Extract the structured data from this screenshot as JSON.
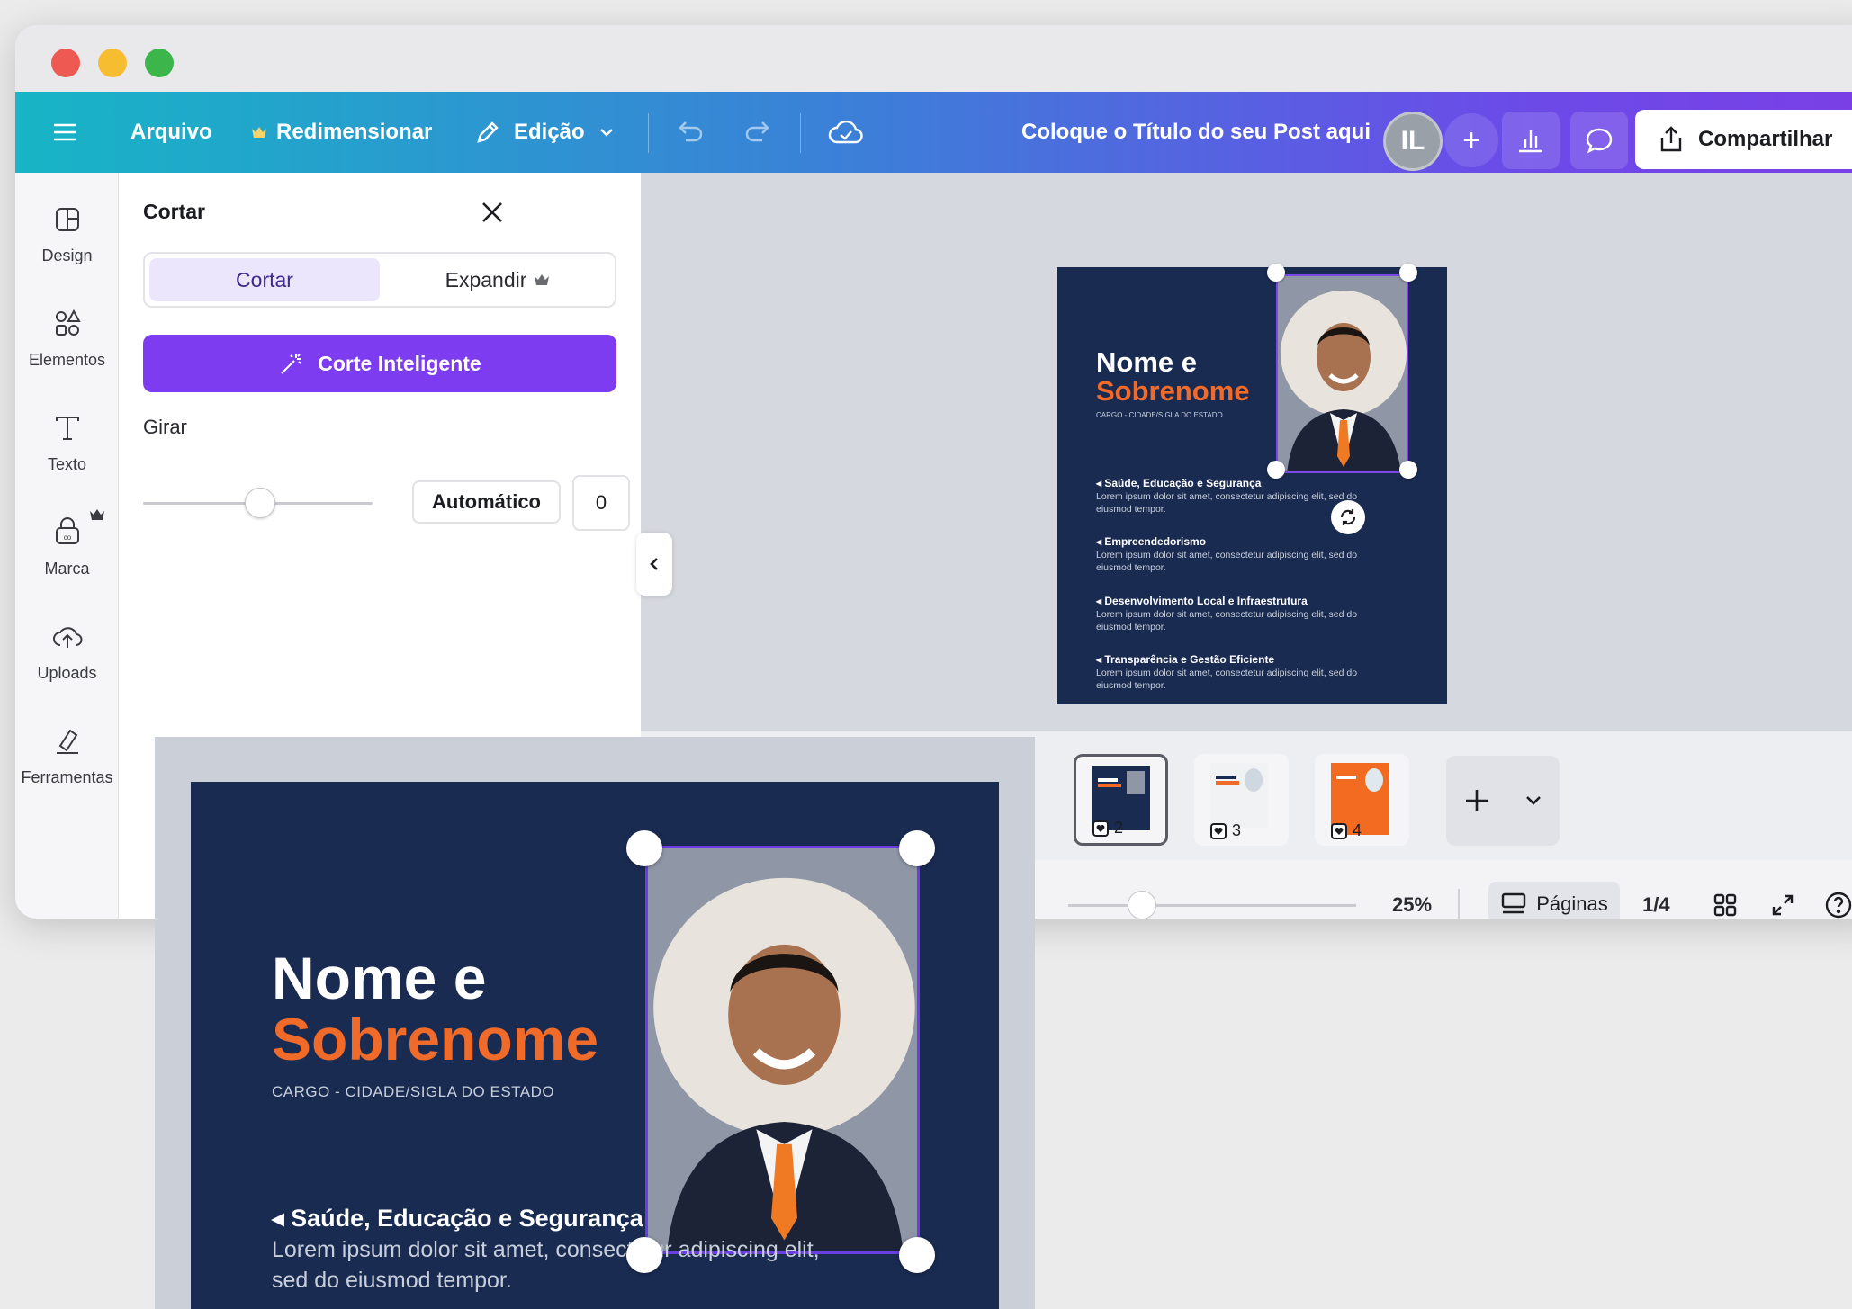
{
  "toolbar": {
    "file": "Arquivo",
    "resize": "Redimensionar",
    "edit": "Edição",
    "title": "Coloque o Título do seu Post aqui",
    "avatar": "IL",
    "share": "Compartilhar"
  },
  "rail": {
    "design": "Design",
    "elements": "Elementos",
    "text": "Texto",
    "brand": "Marca",
    "uploads": "Uploads",
    "tools": "Ferramentas"
  },
  "panel": {
    "title": "Cortar",
    "tab_crop": "Cortar",
    "tab_expand": "Expandir",
    "smart_crop": "Corte Inteligente",
    "rotate_label": "Girar",
    "auto": "Automático",
    "rotate_value": "0"
  },
  "poster": {
    "name_line1": "Nome e",
    "name_line2": "Sobrenome",
    "role": "CARGO - CIDADE/SIGLA DO ESTADO",
    "bullets": [
      {
        "title": "Saúde, Educação e Segurança",
        "text": "Lorem ipsum dolor sit amet, consectetur adipiscing elit, sed do eiusmod tempor."
      },
      {
        "title": "Empreendedorismo",
        "text": "Lorem ipsum dolor sit amet, consectetur adipiscing elit, sed do eiusmod tempor."
      },
      {
        "title": "Desenvolvimento Local e Infraestrutura",
        "text": "Lorem ipsum dolor sit amet, consectetur adipiscing elit, sed do eiusmod tempor."
      },
      {
        "title": "Transparência e Gestão Eficiente",
        "text": "Lorem ipsum dolor sit amet, consectetur adipiscing elit, sed do eiusmod tempor."
      }
    ]
  },
  "zoomed": {
    "text_line1": "Lorem ipsum dolor sit amet, consectetur adipiscing elit,",
    "text_line2": "sed do eiusmod tempor."
  },
  "thumbnails": [
    {
      "num": "2"
    },
    {
      "num": "3"
    },
    {
      "num": "4"
    }
  ],
  "status": {
    "zoom": "25%",
    "pages": "Páginas",
    "page_count": "1/4"
  },
  "colors": {
    "accent_purple": "#7d3cf0",
    "poster_navy": "#1a2b52",
    "poster_orange": "#f06a2a"
  }
}
